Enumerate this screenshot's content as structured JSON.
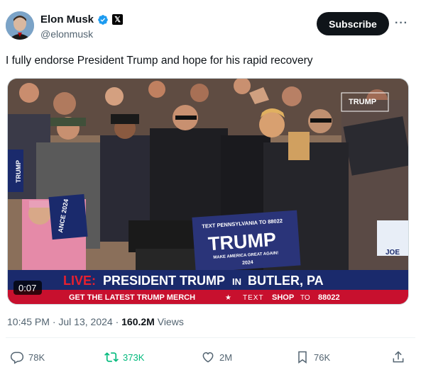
{
  "author": {
    "name": "Elon Musk",
    "handle": "@elonmusk",
    "affiliate_badge": "𝕏"
  },
  "subscribe_label": "Subscribe",
  "more_label": "···",
  "tweet_text": "I fully endorse President Trump and hope for his rapid recovery",
  "media": {
    "duration": "0:07",
    "channel_logo": "TRUMP",
    "sign_top": "TEXT PENNSYLVANIA TO 88022",
    "sign_main": "TRUMP",
    "sign_sub": "MAKE AMERICA GREAT AGAIN!",
    "sign_year": "2024",
    "banner_live": "LIVE:",
    "banner_main": "PRESIDENT TRUMP",
    "banner_in": "IN",
    "banner_loc": "BUTLER, PA",
    "ticker_left": "GET THE LATEST TRUMP MERCH",
    "ticker_star": "★",
    "ticker_text": "TEXT",
    "ticker_shop": "SHOP",
    "ticker_to": "TO",
    "ticker_num": "88022",
    "side_sign_left": "TRUMP",
    "side_sign_mid": "ANCE 2024",
    "side_sign_right": "JOE"
  },
  "meta": {
    "time": "10:45 PM",
    "sep1": " · ",
    "date": "Jul 13, 2024",
    "sep2": " · ",
    "views": "160.2M",
    "views_label": " Views"
  },
  "actions": {
    "replies": "78K",
    "reposts": "373K",
    "likes": "2M",
    "bookmarks": "76K"
  },
  "colors": {
    "verified": "#1d9bf0",
    "repost_active": "#00ba7c",
    "banner_blue": "#1a2a6c",
    "banner_red": "#c8102e"
  }
}
